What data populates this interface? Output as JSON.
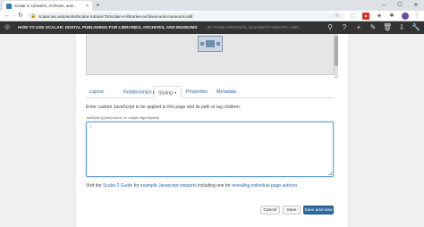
{
  "browser": {
    "tab_title": "Scalar in Libraries, Archives, and...",
    "tab_close": "×",
    "new_tab": "+",
    "window_controls": [
      "–",
      "☐",
      "✕"
    ],
    "url": "scalar.usc.edu/works/scalar-tutorial-75/scalar-in-libraries-archives-and-museums.edit"
  },
  "header": {
    "title": "HOW TO USE SCALAR: DIGITAL PUBLISHING FOR LIBRARIES, ARCHIVES, AND MUSEUMS",
    "byline": "BY PAIGE IORIOGOS, ELIZABETH SWEARY, AND..."
  },
  "tabs": [
    {
      "label": "Layout"
    },
    {
      "label": "Relationships",
      "badge": "1"
    },
    {
      "label": "Styling",
      "active": true
    },
    {
      "label": "Properties"
    },
    {
      "label": "Metadata"
    }
  ],
  "styling": {
    "instructions": "Enter custom JavaScript to be applied to this page and its path or tag children:",
    "field_label": "JavaScript (jQuery source, no <script> tags required)",
    "line_number": "1"
  },
  "help": {
    "prefix": "Visit the",
    "guide_link": "Scalar 2 Guide",
    "middle": "for",
    "snippets_link": "example Javascript snippets",
    "middle2": "including one for",
    "authors_link": "revealing individual page authors",
    "suffix": "."
  },
  "buttons": {
    "cancel": "Cancel",
    "save": "Save",
    "save_view": "Save and view"
  }
}
